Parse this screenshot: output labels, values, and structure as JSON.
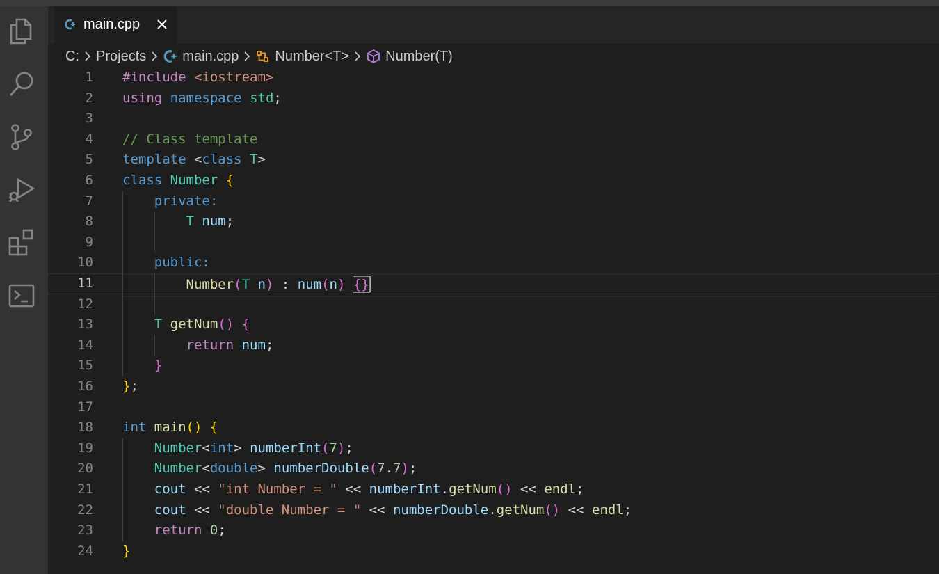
{
  "tab": {
    "title": "main.cpp"
  },
  "breadcrumb": [
    "C:",
    "Projects",
    "main.cpp",
    "Number<T>",
    "Number(T)"
  ],
  "activity_bar": [
    "explorer-icon",
    "search-icon",
    "source-control-icon",
    "run-debug-icon",
    "extensions-icon",
    "terminal-icon"
  ],
  "current_line": 11,
  "code_lines": [
    {
      "n": "1",
      "tokens": [
        [
          "#include ",
          "ctl"
        ],
        [
          "<iostream>",
          "str"
        ]
      ]
    },
    {
      "n": "2",
      "tokens": [
        [
          "using",
          "ctl"
        ],
        [
          " ",
          "plain"
        ],
        [
          "namespace",
          "kw"
        ],
        [
          " ",
          "plain"
        ],
        [
          "std",
          "ty"
        ],
        [
          ";",
          "plain"
        ]
      ]
    },
    {
      "n": "3",
      "tokens": []
    },
    {
      "n": "4",
      "tokens": [
        [
          "// Class template",
          "cm"
        ]
      ]
    },
    {
      "n": "5",
      "tokens": [
        [
          "template",
          "kw"
        ],
        [
          " <",
          "plain"
        ],
        [
          "class",
          "kw"
        ],
        [
          " ",
          "plain"
        ],
        [
          "T",
          "ty"
        ],
        [
          ">",
          "plain"
        ]
      ]
    },
    {
      "n": "6",
      "tokens": [
        [
          "class",
          "kw"
        ],
        [
          " ",
          "plain"
        ],
        [
          "Number",
          "ty"
        ],
        [
          " ",
          "plain"
        ],
        [
          "{",
          "p1"
        ]
      ]
    },
    {
      "n": "7",
      "tokens": [
        [
          "    ",
          "plain"
        ],
        [
          "private",
          "kw"
        ],
        [
          ":",
          "kw"
        ]
      ]
    },
    {
      "n": "8",
      "tokens": [
        [
          "        ",
          "plain"
        ],
        [
          "T",
          "ty"
        ],
        [
          " ",
          "plain"
        ],
        [
          "num",
          "var"
        ],
        [
          ";",
          "plain"
        ]
      ]
    },
    {
      "n": "9",
      "tokens": []
    },
    {
      "n": "10",
      "tokens": [
        [
          "    ",
          "plain"
        ],
        [
          "public",
          "kw"
        ],
        [
          ":",
          "kw"
        ]
      ]
    },
    {
      "n": "11",
      "tokens": [
        [
          "        ",
          "plain"
        ],
        [
          "Number",
          "fn"
        ],
        [
          "(",
          "p2"
        ],
        [
          "T",
          "ty"
        ],
        [
          " ",
          "plain"
        ],
        [
          "n",
          "var"
        ],
        [
          ")",
          "p2"
        ],
        [
          " : ",
          "plain"
        ],
        [
          "num",
          "var"
        ],
        [
          "(",
          "p2"
        ],
        [
          "n",
          "var"
        ],
        [
          ")",
          "p2"
        ],
        [
          " ",
          "plain"
        ],
        [
          "{}",
          "p2"
        ]
      ]
    },
    {
      "n": "12",
      "tokens": []
    },
    {
      "n": "13",
      "tokens": [
        [
          "    ",
          "plain"
        ],
        [
          "T",
          "ty"
        ],
        [
          " ",
          "plain"
        ],
        [
          "getNum",
          "fn"
        ],
        [
          "()",
          "p2"
        ],
        [
          " ",
          "plain"
        ],
        [
          "{",
          "p2"
        ]
      ]
    },
    {
      "n": "14",
      "tokens": [
        [
          "        ",
          "plain"
        ],
        [
          "return",
          "ctl"
        ],
        [
          " ",
          "plain"
        ],
        [
          "num",
          "var"
        ],
        [
          ";",
          "plain"
        ]
      ]
    },
    {
      "n": "15",
      "tokens": [
        [
          "    ",
          "plain"
        ],
        [
          "}",
          "p2"
        ]
      ]
    },
    {
      "n": "16",
      "tokens": [
        [
          "}",
          "p1"
        ],
        [
          ";",
          "plain"
        ]
      ]
    },
    {
      "n": "17",
      "tokens": []
    },
    {
      "n": "18",
      "tokens": [
        [
          "int",
          "kw"
        ],
        [
          " ",
          "plain"
        ],
        [
          "main",
          "fn"
        ],
        [
          "()",
          "p1"
        ],
        [
          " ",
          "plain"
        ],
        [
          "{",
          "p1"
        ]
      ]
    },
    {
      "n": "19",
      "tokens": [
        [
          "    ",
          "plain"
        ],
        [
          "Number",
          "ty"
        ],
        [
          "<",
          "plain"
        ],
        [
          "int",
          "kw"
        ],
        [
          "> ",
          "plain"
        ],
        [
          "numberInt",
          "var"
        ],
        [
          "(",
          "p2"
        ],
        [
          "7",
          "num"
        ],
        [
          ")",
          "p2"
        ],
        [
          ";",
          "plain"
        ]
      ]
    },
    {
      "n": "20",
      "tokens": [
        [
          "    ",
          "plain"
        ],
        [
          "Number",
          "ty"
        ],
        [
          "<",
          "plain"
        ],
        [
          "double",
          "kw"
        ],
        [
          "> ",
          "plain"
        ],
        [
          "numberDouble",
          "var"
        ],
        [
          "(",
          "p2"
        ],
        [
          "7.7",
          "num"
        ],
        [
          ")",
          "p2"
        ],
        [
          ";",
          "plain"
        ]
      ]
    },
    {
      "n": "21",
      "tokens": [
        [
          "    ",
          "plain"
        ],
        [
          "cout",
          "var"
        ],
        [
          " << ",
          "plain"
        ],
        [
          "\"int Number = \"",
          "str"
        ],
        [
          " << ",
          "plain"
        ],
        [
          "numberInt",
          "var"
        ],
        [
          ".",
          "plain"
        ],
        [
          "getNum",
          "fn"
        ],
        [
          "()",
          "p2"
        ],
        [
          " << ",
          "plain"
        ],
        [
          "endl",
          "fn"
        ],
        [
          ";",
          "plain"
        ]
      ]
    },
    {
      "n": "22",
      "tokens": [
        [
          "    ",
          "plain"
        ],
        [
          "cout",
          "var"
        ],
        [
          " << ",
          "plain"
        ],
        [
          "\"double Number = \"",
          "str"
        ],
        [
          " << ",
          "plain"
        ],
        [
          "numberDouble",
          "var"
        ],
        [
          ".",
          "plain"
        ],
        [
          "getNum",
          "fn"
        ],
        [
          "()",
          "p2"
        ],
        [
          " << ",
          "plain"
        ],
        [
          "endl",
          "fn"
        ],
        [
          ";",
          "plain"
        ]
      ]
    },
    {
      "n": "23",
      "tokens": [
        [
          "    ",
          "plain"
        ],
        [
          "return",
          "ctl"
        ],
        [
          " ",
          "plain"
        ],
        [
          "0",
          "num"
        ],
        [
          ";",
          "plain"
        ]
      ]
    },
    {
      "n": "24",
      "tokens": [
        [
          "}",
          "p1"
        ]
      ]
    }
  ]
}
